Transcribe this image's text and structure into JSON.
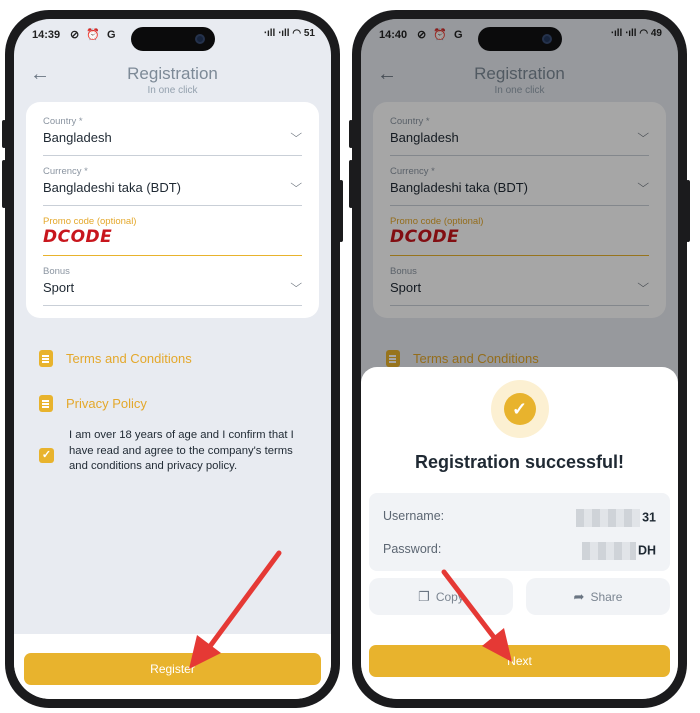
{
  "left": {
    "status": {
      "time": "14:39",
      "icons": "⊘ ⏰ G",
      "right": "‧ıll ‧ıll ◠ 51"
    },
    "appbar": {
      "title": "Registration",
      "subtitle": "In one click",
      "back": "←"
    },
    "form": {
      "country": {
        "label": "Country *",
        "value": "Bangladesh"
      },
      "currency": {
        "label": "Currency *",
        "value": "Bangladeshi taka (BDT)"
      },
      "promo": {
        "label": "Promo code (optional)",
        "value": "DCODE"
      },
      "bonus": {
        "label": "Bonus",
        "value": "Sport"
      }
    },
    "links": {
      "terms": "Terms and Conditions",
      "privacy": "Privacy Policy"
    },
    "agreement": "I am over 18 years of age and I confirm that I have read and agree to the company's terms and conditions and privacy policy.",
    "register_label": "Register"
  },
  "right": {
    "status": {
      "time": "14:40",
      "icons": "⊘ ⏰ G",
      "right": "‧ıll ‧ıll ◠ 49"
    },
    "appbar": {
      "title": "Registration",
      "subtitle": "In one click",
      "back": "←"
    },
    "form": {
      "country": {
        "label": "Country *",
        "value": "Bangladesh"
      },
      "currency": {
        "label": "Currency *",
        "value": "Bangladeshi taka (BDT)"
      },
      "promo": {
        "label": "Promo code (optional)",
        "value": "DCODE"
      },
      "bonus": {
        "label": "Bonus",
        "value": "Sport"
      }
    },
    "links": {
      "terms": "Terms and Conditions"
    },
    "success": {
      "title": "Registration successful!",
      "username_label": "Username:",
      "username_value": "31",
      "password_label": "Password:",
      "password_value": "DH",
      "copy_label": "Copy",
      "share_label": "Share",
      "next_label": "Next"
    }
  },
  "colors": {
    "accent": "#e8b32d",
    "promo_text": "#c8161d",
    "arrow": "#e53935"
  }
}
